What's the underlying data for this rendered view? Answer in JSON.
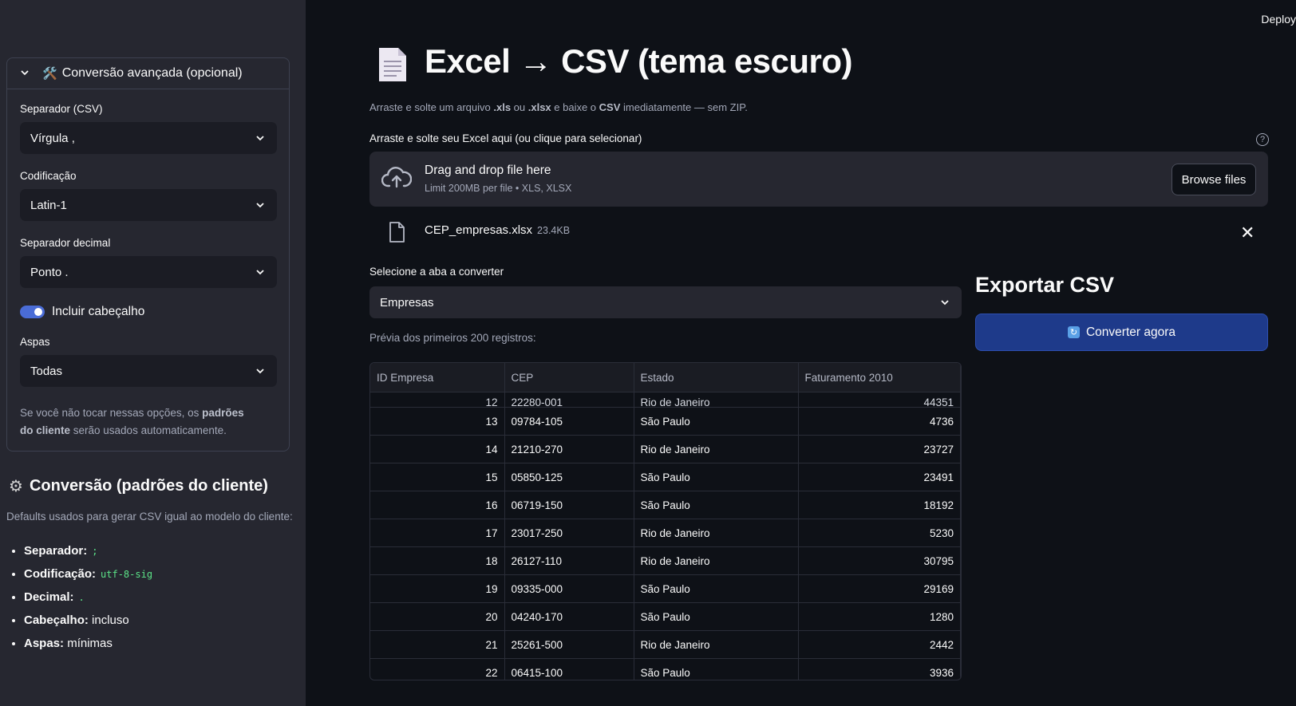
{
  "deploy_label": "Deploy",
  "sidebar": {
    "expander": {
      "title": "Conversão avançada (opcional)",
      "fields": {
        "separator": {
          "label": "Separador (CSV)",
          "value": "Vírgula ,"
        },
        "encoding": {
          "label": "Codificação",
          "value": "Latin-1"
        },
        "decimal": {
          "label": "Separador decimal",
          "value": "Ponto ."
        },
        "header_toggle": {
          "label": "Incluir cabeçalho",
          "checked": true
        },
        "quotes": {
          "label": "Aspas",
          "value": "Todas"
        }
      },
      "note": {
        "prefix": "Se você não tocar nessas opções, os ",
        "bold": "padrões do cliente",
        "suffix": " serão usados automaticamente."
      }
    },
    "defaults": {
      "title": "Conversão (padrões do cliente)",
      "subtitle": "Defaults usados para gerar CSV igual ao modelo do cliente:",
      "items": [
        {
          "key": "Separador:",
          "code": ";",
          "text": ""
        },
        {
          "key": "Codificação:",
          "code": "utf-8-sig",
          "text": ""
        },
        {
          "key": "Decimal:",
          "code": ".",
          "text": ""
        },
        {
          "key": "Cabeçalho:",
          "code": "",
          "text": "incluso"
        },
        {
          "key": "Aspas:",
          "code": "",
          "text": "mínimas"
        }
      ]
    }
  },
  "main": {
    "title": "Excel → CSV (tema escuro)",
    "caption": {
      "p1": "Arraste e solte um arquivo ",
      "b1": ".xls",
      "p2": " ou ",
      "b2": ".xlsx",
      "p3": " e baixe o ",
      "b3": "CSV",
      "p4": " imediatamente — sem ZIP."
    },
    "uploader": {
      "label": "Arraste e solte seu Excel aqui (ou clique para selecionar)",
      "drop_title": "Drag and drop file here",
      "limit": "Limit 200MB per file • XLS, XLSX",
      "browse_label": "Browse files",
      "file": {
        "name": "CEP_empresas.xlsx",
        "size": "23.4KB"
      }
    },
    "sheet": {
      "label": "Selecione a aba a converter",
      "value": "Empresas"
    },
    "preview_note": "Prévia dos primeiros 200 registros:",
    "table": {
      "columns": [
        "ID Empresa",
        "CEP",
        "Estado",
        "Faturamento 2010"
      ],
      "rows": [
        [
          "12",
          "22280-001",
          "Rio de Janeiro",
          "44351"
        ],
        [
          "13",
          "09784-105",
          "São Paulo",
          "4736"
        ],
        [
          "14",
          "21210-270",
          "Rio de Janeiro",
          "23727"
        ],
        [
          "15",
          "05850-125",
          "São Paulo",
          "23491"
        ],
        [
          "16",
          "06719-150",
          "São Paulo",
          "18192"
        ],
        [
          "17",
          "23017-250",
          "Rio de Janeiro",
          "5230"
        ],
        [
          "18",
          "26127-110",
          "Rio de Janeiro",
          "30795"
        ],
        [
          "19",
          "09335-000",
          "São Paulo",
          "29169"
        ],
        [
          "20",
          "04240-170",
          "São Paulo",
          "1280"
        ],
        [
          "21",
          "25261-500",
          "Rio de Janeiro",
          "2442"
        ],
        [
          "22",
          "06415-100",
          "São Paulo",
          "3936"
        ]
      ]
    },
    "export": {
      "title": "Exportar CSV",
      "button_label": "Converter agora"
    }
  },
  "colors": {
    "accent_button": "#1e3a8a",
    "toggle": "#4a6cd6",
    "code": "#5ce488",
    "background": "#0e1117",
    "sidebar": "#262730"
  }
}
